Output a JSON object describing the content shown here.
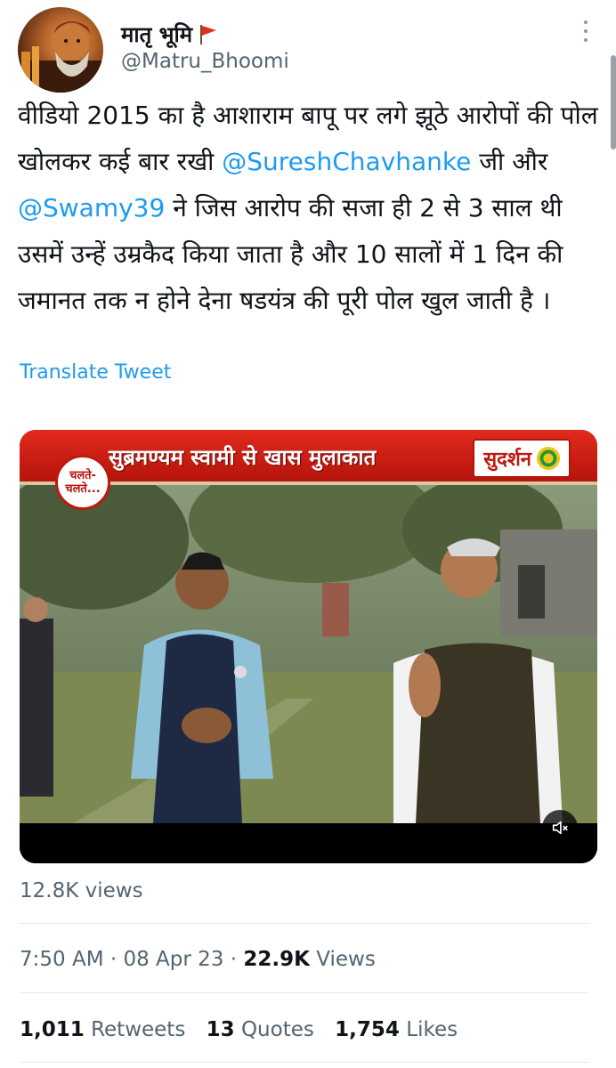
{
  "author": {
    "display_name": "मातृ भूमि",
    "handle": "@Matru_Bhoomi"
  },
  "tweet": {
    "segments": [
      {
        "text": "वीडियो 2015 का है आशाराम बापू पर लगे झूठे आरोपों की पोल खोलकर कई बार रखी ",
        "mention": false
      },
      {
        "text": "@SureshChavhanke",
        "mention": true
      },
      {
        "text": " जी और ",
        "mention": false
      },
      {
        "text": "@Swamy39",
        "mention": true
      },
      {
        "text": "  ने जिस आरोप की सजा ही 2 से 3 साल थी उसमें उन्हें उम्रकैद किया जाता है और 10 सालों में 1 दिन की जमानत तक न होने देना षडयंत्र की पूरी पोल खुल जाती है ।",
        "mention": false
      }
    ],
    "translate_label": "Translate Tweet"
  },
  "media": {
    "banner_left": "चलते-चलते...",
    "banner_title": "सुब्रमण्यम स्वामी से खास मुलाकात",
    "banner_logo": "सुदर्शन"
  },
  "stats": {
    "views_label": "12.8K views",
    "time": "7:50 AM",
    "date": "08 Apr 23",
    "views_count": "22.9K",
    "views_word": "Views",
    "retweets_count": "1,011",
    "retweets_label": "Retweets",
    "quotes_count": "13",
    "quotes_label": "Quotes",
    "likes_count": "1,754",
    "likes_label": "Likes"
  },
  "colors": {
    "link": "#1d9bf0",
    "secondary_text": "#536471",
    "banner_red": "#e22a1c"
  }
}
